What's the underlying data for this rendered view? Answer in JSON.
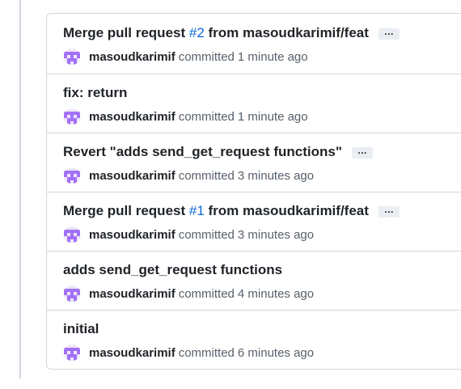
{
  "commits": [
    {
      "title_prefix": "Merge pull request ",
      "pr_number": "#2",
      "title_suffix": " from masoudkarimif/feat",
      "ellipsis": "…",
      "author": "masoudkarimif",
      "action": "committed",
      "time": "1 minute ago"
    },
    {
      "title": "fix: return",
      "author": "masoudkarimif",
      "action": "committed",
      "time": "1 minute ago"
    },
    {
      "title": "Revert \"adds send_get_request functions\"",
      "ellipsis": "…",
      "author": "masoudkarimif",
      "action": "committed",
      "time": "3 minutes ago"
    },
    {
      "title_prefix": "Merge pull request ",
      "pr_number": "#1",
      "title_suffix": " from masoudkarimif/feat",
      "ellipsis": "…",
      "author": "masoudkarimif",
      "action": "committed",
      "time": "3 minutes ago"
    },
    {
      "title": "adds send_get_request functions",
      "author": "masoudkarimif",
      "action": "committed",
      "time": "4 minutes ago"
    },
    {
      "title": "initial",
      "author": "masoudkarimif",
      "action": "committed",
      "time": "6 minutes ago"
    }
  ],
  "avatar_icon": "identicon-avatar",
  "colors": {
    "link": "#0969da",
    "border": "#d0d7de",
    "avatar": "#a371f7",
    "muted": "#57606a"
  }
}
